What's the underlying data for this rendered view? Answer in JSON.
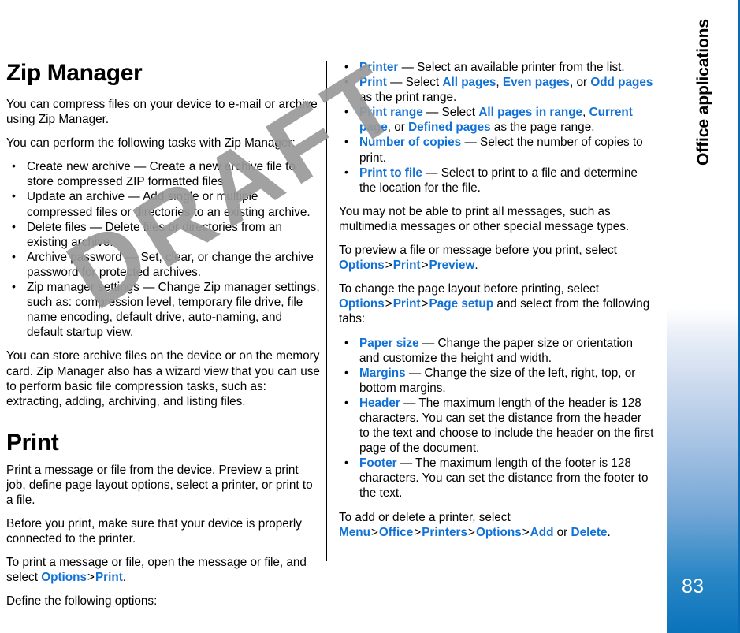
{
  "sidebar": {
    "chapter_title": "Office applications",
    "page_number": "83",
    "accent_color": "#0b73ba",
    "gradient_top_color": "#ffffff",
    "gradient_bottom_color": "#0b73ba"
  },
  "watermark": {
    "text": "DRAFT",
    "color": "#9a9a9a"
  },
  "link_color": "#1171d6",
  "left_column": {
    "heading": "Zip Manager",
    "intro_paragraph": "You can compress files on your device to e-mail or archive using Zip Manager.",
    "tasks_lead": "You can perform the following tasks with Zip Manager:",
    "bullets": [
      {
        "term": "Create new archive",
        "dash": "—",
        "description": "Create a new archive file to store compressed ZIP formatted files."
      },
      {
        "term": "Update an archive",
        "dash": "—",
        "description": "Add single or multiple compressed files or directories to an existing archive."
      },
      {
        "term": "Delete files",
        "dash": "—",
        "description": "Delete files or directories from an existing archive."
      },
      {
        "term": "Archive password",
        "dash": "—",
        "description": "Set, clear, or change the archive password for protected archives."
      },
      {
        "term": "Zip manager settings",
        "dash": "—",
        "description": "Change Zip manager settings, such as: compression level, temporary file drive, file name encoding, default drive, auto-naming, and default startup view."
      }
    ],
    "storage_paragraph": "You can store archive files on the device or on the memory card. Zip Manager also has a wizard view that you can use to perform basic file compression tasks, such as: extracting, adding, archiving, and listing files.",
    "print_heading": "Print",
    "print_intro": "Print a message or file from the device. Preview a print job, define page layout options, select a printer, or print to a file.",
    "print_connection": "Before you print, make sure that your device is properly connected to the printer.",
    "print_howto": {
      "prefix": "To print a message or file, open the message or file, and select ",
      "path": [
        "Options",
        "Print"
      ],
      "separator": ">",
      "suffix": "."
    },
    "define_options_lead": "Define the following options:"
  },
  "right_column": {
    "option_bullets": [
      {
        "term": "Printer",
        "dash": "—",
        "text_parts": [
          "Select an available printer from the list."
        ],
        "inline_links": []
      },
      {
        "term": "Print",
        "dash": "—",
        "text_before": "Select ",
        "inline_links": [
          "All pages",
          "Even pages",
          "Odd pages"
        ],
        "text_after": " as the print range."
      },
      {
        "term": "Print range",
        "dash": "—",
        "text_before": "Select ",
        "inline_links": [
          "All pages in range",
          "Current page",
          "Defined pages"
        ],
        "text_after": " as the page range."
      },
      {
        "term": "Number of copies",
        "dash": "—",
        "text_parts": [
          "Select the number of copies to print."
        ],
        "inline_links": []
      },
      {
        "term": "Print to file",
        "dash": "—",
        "text_parts": [
          "Select to print to a file and determine the location for the file."
        ],
        "inline_links": []
      }
    ],
    "limitation_paragraph": "You may not be able to print all messages, such as multimedia messages or other special message types.",
    "preview_paragraph": {
      "prefix": "To preview a file or message before you print, select ",
      "path": [
        "Options",
        "Print",
        "Preview"
      ],
      "separator": ">",
      "suffix": "."
    },
    "page_layout_paragraph": {
      "prefix": "To change the page layout before printing, select ",
      "path": [
        "Options",
        "Print",
        "Page setup"
      ],
      "separator": ">",
      "middle": " and select from the following tabs:"
    },
    "tab_bullets": [
      {
        "term": "Paper size",
        "dash": "—",
        "description": "Change the paper size or orientation and customize the height and width."
      },
      {
        "term": "Margins",
        "dash": "—",
        "description": "Change the size of the left, right, top, or bottom margins."
      },
      {
        "term": "Header",
        "dash": "—",
        "description": "The maximum length of the header is 128 characters. You can set the distance from the header to the text and choose to include the header on the first page of the document."
      },
      {
        "term": "Footer",
        "dash": "—",
        "description": "The maximum length of the footer is 128 characters. You can set the distance from the footer to the text."
      }
    ],
    "add_delete_printer": {
      "prefix": "To add or delete a printer, select ",
      "path": [
        "Menu",
        "Office",
        "Printers",
        "Options"
      ],
      "separator": ">",
      "action_a": "Add",
      "conjunction": " or ",
      "action_b": "Delete",
      "suffix": "."
    }
  }
}
